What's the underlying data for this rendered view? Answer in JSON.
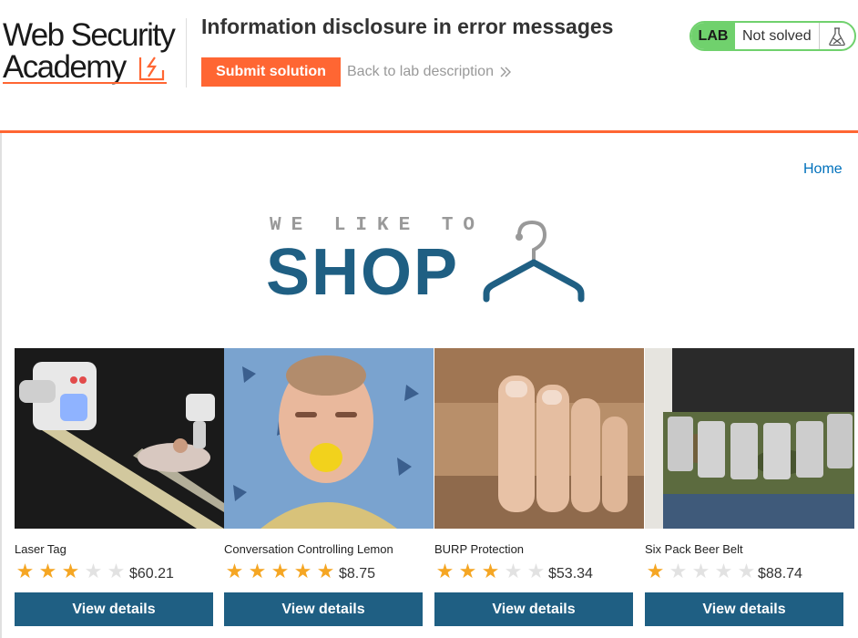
{
  "header": {
    "logo_line1": "Web Security",
    "logo_line2": "Academy",
    "lab_title": "Information disclosure in error messages",
    "submit_label": "Submit solution",
    "back_label": "Back to lab description",
    "back_icon": "double-chevron-right-icon",
    "status_badge": "LAB",
    "status_text": "Not solved",
    "flask_icon": "flask-icon",
    "accent_color": "#ff6633",
    "status_color": "#70d16d"
  },
  "nav": {
    "home_label": "Home"
  },
  "banner": {
    "tagline": "WE LIKE TO",
    "shop_text": "SHOP",
    "hanger_icon": "clothes-hanger-icon",
    "brand_color": "#1f5f83"
  },
  "products": [
    {
      "name": "Laser Tag",
      "rating": 3,
      "price": "$60.21",
      "button": "View details"
    },
    {
      "name": "Conversation Controlling Lemon",
      "rating": 5,
      "price": "$8.75",
      "button": "View details"
    },
    {
      "name": "BURP Protection",
      "rating": 3,
      "price": "$53.34",
      "button": "View details"
    },
    {
      "name": "Six Pack Beer Belt",
      "rating": 1,
      "price": "$88.74",
      "button": "View details"
    }
  ]
}
